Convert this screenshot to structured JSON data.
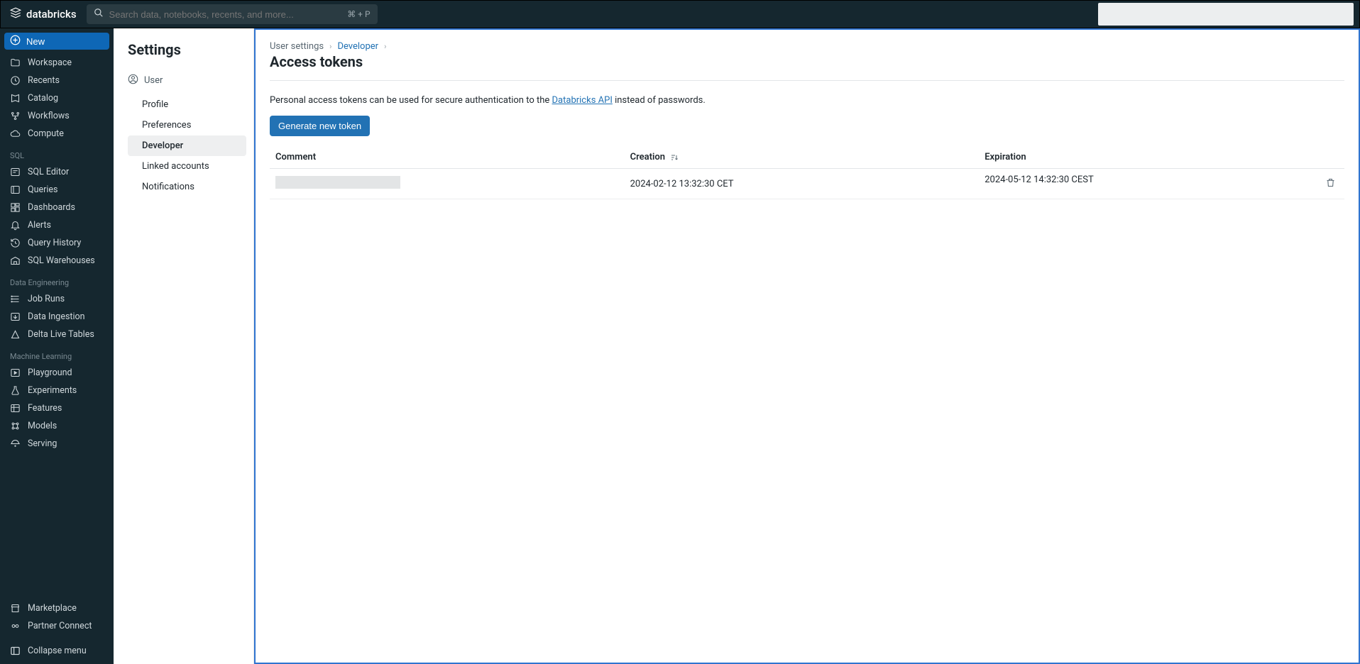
{
  "topbar": {
    "brand": "databricks",
    "search_placeholder": "Search data, notebooks, recents, and more...",
    "search_shortcut": "⌘ + P"
  },
  "sidebar": {
    "new_label": "New",
    "primary": [
      {
        "label": "Workspace",
        "icon": "folder"
      },
      {
        "label": "Recents",
        "icon": "clock"
      },
      {
        "label": "Catalog",
        "icon": "book"
      },
      {
        "label": "Workflows",
        "icon": "flow"
      },
      {
        "label": "Compute",
        "icon": "cloud"
      }
    ],
    "groups": [
      {
        "title": "SQL",
        "items": [
          {
            "label": "SQL Editor",
            "icon": "editor"
          },
          {
            "label": "Queries",
            "icon": "query"
          },
          {
            "label": "Dashboards",
            "icon": "dashboard"
          },
          {
            "label": "Alerts",
            "icon": "bell"
          },
          {
            "label": "Query History",
            "icon": "history"
          },
          {
            "label": "SQL Warehouses",
            "icon": "warehouse"
          }
        ]
      },
      {
        "title": "Data Engineering",
        "items": [
          {
            "label": "Job Runs",
            "icon": "runs"
          },
          {
            "label": "Data Ingestion",
            "icon": "ingest"
          },
          {
            "label": "Delta Live Tables",
            "icon": "delta"
          }
        ]
      },
      {
        "title": "Machine Learning",
        "items": [
          {
            "label": "Playground",
            "icon": "play"
          },
          {
            "label": "Experiments",
            "icon": "flask"
          },
          {
            "label": "Features",
            "icon": "features"
          },
          {
            "label": "Models",
            "icon": "models"
          },
          {
            "label": "Serving",
            "icon": "serving"
          }
        ]
      }
    ],
    "bottom": [
      {
        "label": "Marketplace",
        "icon": "store"
      },
      {
        "label": "Partner Connect",
        "icon": "partner"
      }
    ],
    "collapse_label": "Collapse menu"
  },
  "settings_panel": {
    "title": "Settings",
    "group_label": "User",
    "items": [
      {
        "label": "Profile",
        "active": false
      },
      {
        "label": "Preferences",
        "active": false
      },
      {
        "label": "Developer",
        "active": true
      },
      {
        "label": "Linked accounts",
        "active": false
      },
      {
        "label": "Notifications",
        "active": false
      }
    ]
  },
  "main": {
    "breadcrumb": {
      "root": "User settings",
      "current": "Developer"
    },
    "title": "Access tokens",
    "description_prefix": "Personal access tokens can be used for secure authentication to the ",
    "description_link": "Databricks API",
    "description_suffix": " instead of passwords.",
    "generate_button": "Generate new token",
    "table": {
      "headers": {
        "comment": "Comment",
        "creation": "Creation",
        "expiration": "Expiration"
      },
      "rows": [
        {
          "comment": "",
          "creation": "2024-02-12 13:32:30 CET",
          "expiration": "2024-05-12 14:32:30 CEST"
        }
      ]
    }
  }
}
